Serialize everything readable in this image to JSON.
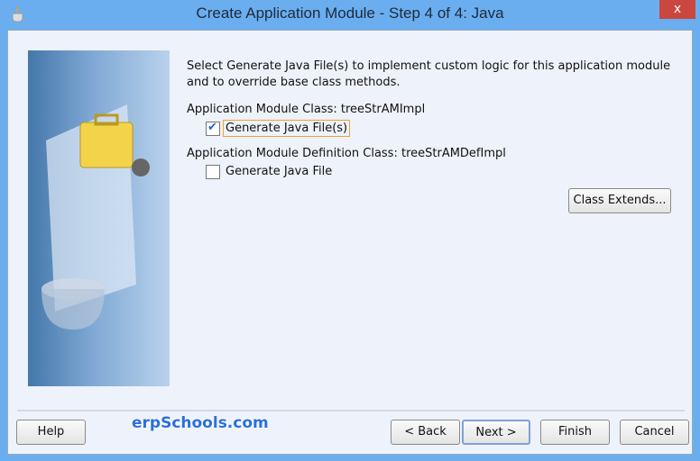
{
  "window": {
    "title": "Create Application Module - Step 4 of 4: Java",
    "close_label": "x"
  },
  "intro": "Select Generate Java File(s) to implement custom logic for this application module and to override base class methods.",
  "am_class": {
    "label": "Application Module Class: treeStrAMImpl",
    "checkbox_label": "Generate Java File(s)",
    "checked": true
  },
  "am_def_class": {
    "label": "Application Module Definition Class: treeStrAMDefImpl",
    "checkbox_label": "Generate Java File",
    "checked": false
  },
  "class_extends_label": "Class Extends...",
  "footer": {
    "help": "Help",
    "watermark": "erpSchools.com",
    "back": "< Back",
    "next": "Next >",
    "finish": "Finish",
    "cancel": "Cancel"
  },
  "colors": {
    "titlebar": "#6aaef0",
    "close": "#c9473e",
    "focus": "#f0a030"
  }
}
